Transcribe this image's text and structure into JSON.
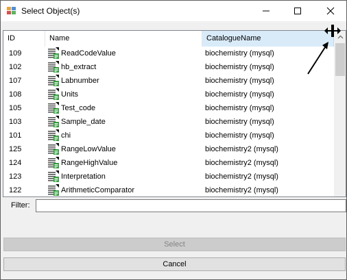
{
  "window": {
    "title": "Select Object(s)"
  },
  "table": {
    "columns": [
      "ID",
      "Name",
      "CatalogueName"
    ],
    "rows": [
      {
        "id": "109",
        "name": "ReadCodeValue",
        "catalogue": "biochemistry (mysql)"
      },
      {
        "id": "102",
        "name": "hb_extract",
        "catalogue": "biochemistry (mysql)"
      },
      {
        "id": "107",
        "name": "Labnumber",
        "catalogue": "biochemistry (mysql)"
      },
      {
        "id": "108",
        "name": "Units",
        "catalogue": "biochemistry (mysql)"
      },
      {
        "id": "105",
        "name": "Test_code",
        "catalogue": "biochemistry (mysql)"
      },
      {
        "id": "103",
        "name": "Sample_date",
        "catalogue": "biochemistry (mysql)"
      },
      {
        "id": "101",
        "name": "chi",
        "catalogue": "biochemistry (mysql)"
      },
      {
        "id": "125",
        "name": "RangeLowValue",
        "catalogue": "biochemistry2 (mysql)"
      },
      {
        "id": "124",
        "name": "RangeHighValue",
        "catalogue": "biochemistry2 (mysql)"
      },
      {
        "id": "123",
        "name": "Interpretation",
        "catalogue": "biochemistry2 (mysql)"
      },
      {
        "id": "122",
        "name": "ArithmeticComparator",
        "catalogue": "biochemistry2 (mysql)"
      }
    ],
    "row_icon": "catalogue-item-icon"
  },
  "filter": {
    "label": "Filter:",
    "value": ""
  },
  "buttons": {
    "select": "Select",
    "cancel": "Cancel"
  },
  "colors": {
    "sorted_header": "#d9ebf9",
    "icon_green": "#2e9e3a"
  }
}
